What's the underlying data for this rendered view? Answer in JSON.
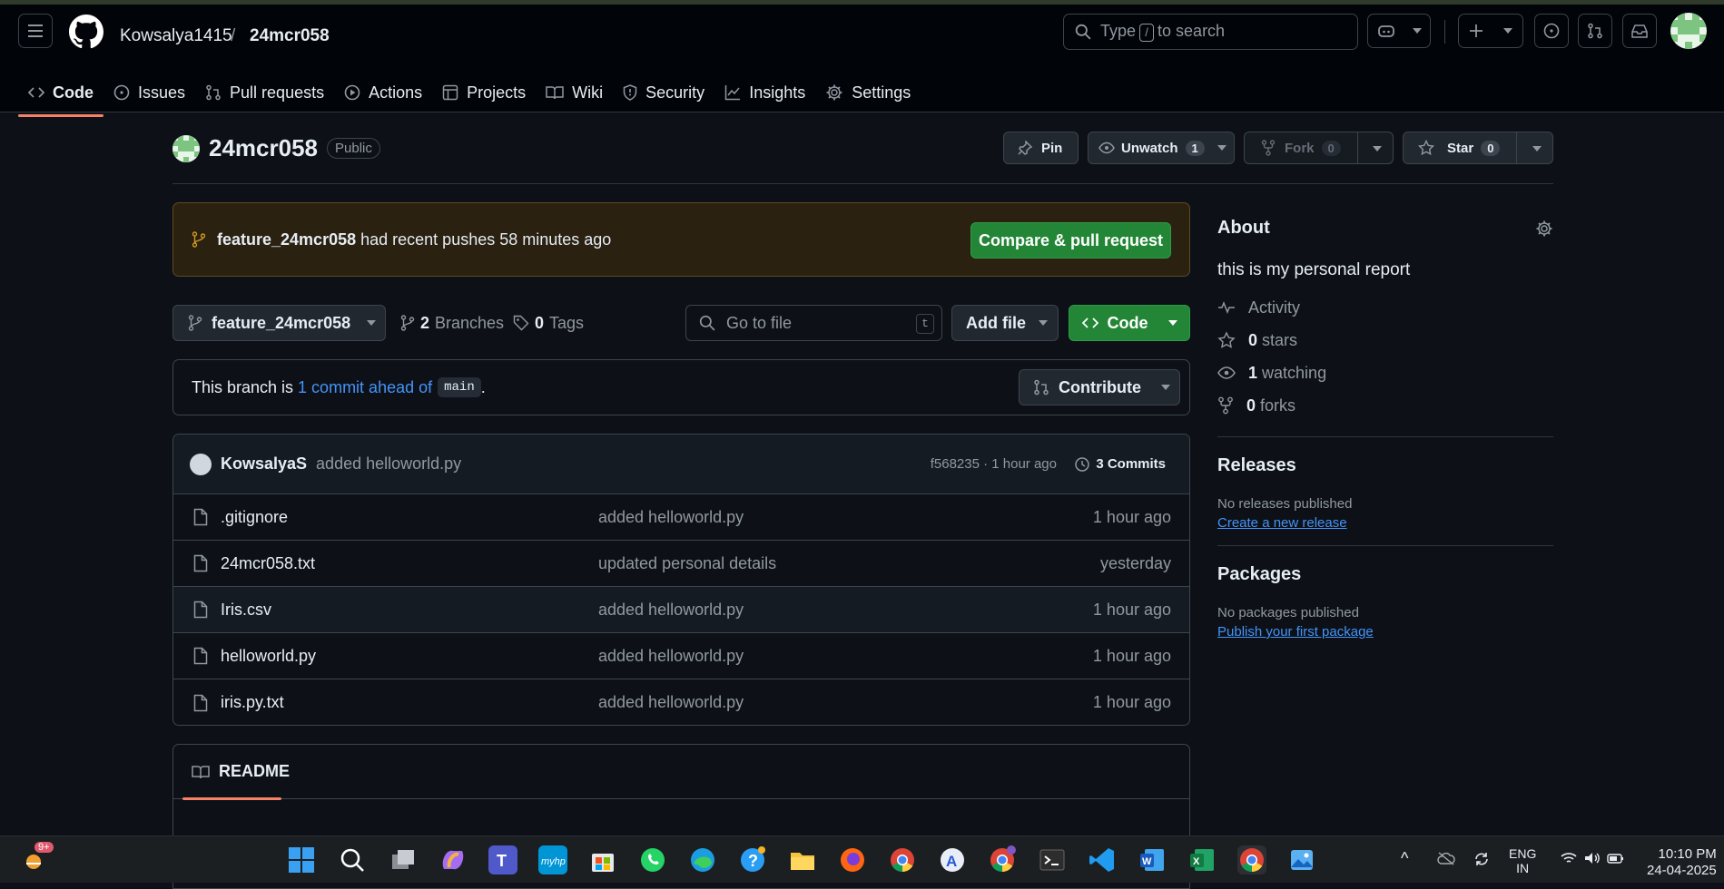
{
  "header": {
    "owner": "Kowsalya1415",
    "separator": "/",
    "repo": "24mcr058",
    "search_prefix": "Type",
    "search_key": "/",
    "search_suffix": "to search"
  },
  "tabs": [
    {
      "label": "Code",
      "icon": "code-icon",
      "active": true
    },
    {
      "label": "Issues",
      "icon": "issue-icon"
    },
    {
      "label": "Pull requests",
      "icon": "pull-request-icon"
    },
    {
      "label": "Actions",
      "icon": "play-icon"
    },
    {
      "label": "Projects",
      "icon": "table-icon"
    },
    {
      "label": "Wiki",
      "icon": "book-icon"
    },
    {
      "label": "Security",
      "icon": "shield-icon"
    },
    {
      "label": "Insights",
      "icon": "graph-icon"
    },
    {
      "label": "Settings",
      "icon": "gear-icon"
    }
  ],
  "repo": {
    "name": "24mcr058",
    "visibility": "Public",
    "pin_label": "Pin",
    "watch_label": "Unwatch",
    "watch_count": "1",
    "fork_label": "Fork",
    "fork_count": "0",
    "star_label": "Star",
    "star_count": "0"
  },
  "banner": {
    "branch": "feature_24mcr058",
    "text": "had recent pushes 58 minutes ago",
    "button": "Compare & pull request"
  },
  "toolbar": {
    "branch": "feature_24mcr058",
    "branches_count": "2",
    "branches_label": "Branches",
    "tags_count": "0",
    "tags_label": "Tags",
    "goto_placeholder": "Go to file",
    "goto_key": "t",
    "addfile_label": "Add file",
    "code_label": "Code"
  },
  "ahead": {
    "prefix": "This branch is",
    "link": "1 commit ahead of",
    "base": "main",
    "suffix": ".",
    "contribute_label": "Contribute"
  },
  "commit": {
    "author": "KowsalyaS",
    "message": "added helloworld.py",
    "hash_time": "f568235 · 1 hour ago",
    "commits_label": "3 Commits"
  },
  "files": [
    {
      "name": ".gitignore",
      "message": "added helloworld.py",
      "time": "1 hour ago"
    },
    {
      "name": "24mcr058.txt",
      "message": "updated personal details",
      "time": "yesterday"
    },
    {
      "name": "Iris.csv",
      "message": "added helloworld.py",
      "time": "1 hour ago"
    },
    {
      "name": "helloworld.py",
      "message": "added helloworld.py",
      "time": "1 hour ago"
    },
    {
      "name": "iris.py.txt",
      "message": "added helloworld.py",
      "time": "1 hour ago"
    }
  ],
  "readme": {
    "label": "README"
  },
  "about": {
    "title": "About",
    "description": "this is my personal report",
    "activity": "Activity",
    "stars_count": "0",
    "stars_label": "stars",
    "watching_count": "1",
    "watching_label": "watching",
    "forks_count": "0",
    "forks_label": "forks"
  },
  "releases": {
    "title": "Releases",
    "empty": "No releases published",
    "link": "Create a new release"
  },
  "packages": {
    "title": "Packages",
    "empty": "No packages published",
    "link": "Publish your first package"
  },
  "taskbar": {
    "notification_badge": "9+",
    "lang_top": "ENG",
    "lang_bottom": "IN",
    "time": "10:10 PM",
    "date": "24-04-2025",
    "apps": [
      "start-icon",
      "search-icon",
      "task-view-icon",
      "copilot-icon",
      "teams-icon",
      "myhp-icon",
      "store-icon",
      "whatsapp-icon",
      "edge-icon",
      "help-icon",
      "file-explorer-icon",
      "firefox-icon",
      "chrome-icon",
      "app-a-icon",
      "chrome-profile-icon",
      "terminal-icon",
      "vscode-icon",
      "word-icon",
      "excel-icon",
      "chrome-active-icon",
      "photos-icon"
    ]
  },
  "colors": {
    "accent": "#f78166",
    "green": "#238636",
    "link": "#4493f8",
    "bg": "#0d1117"
  }
}
